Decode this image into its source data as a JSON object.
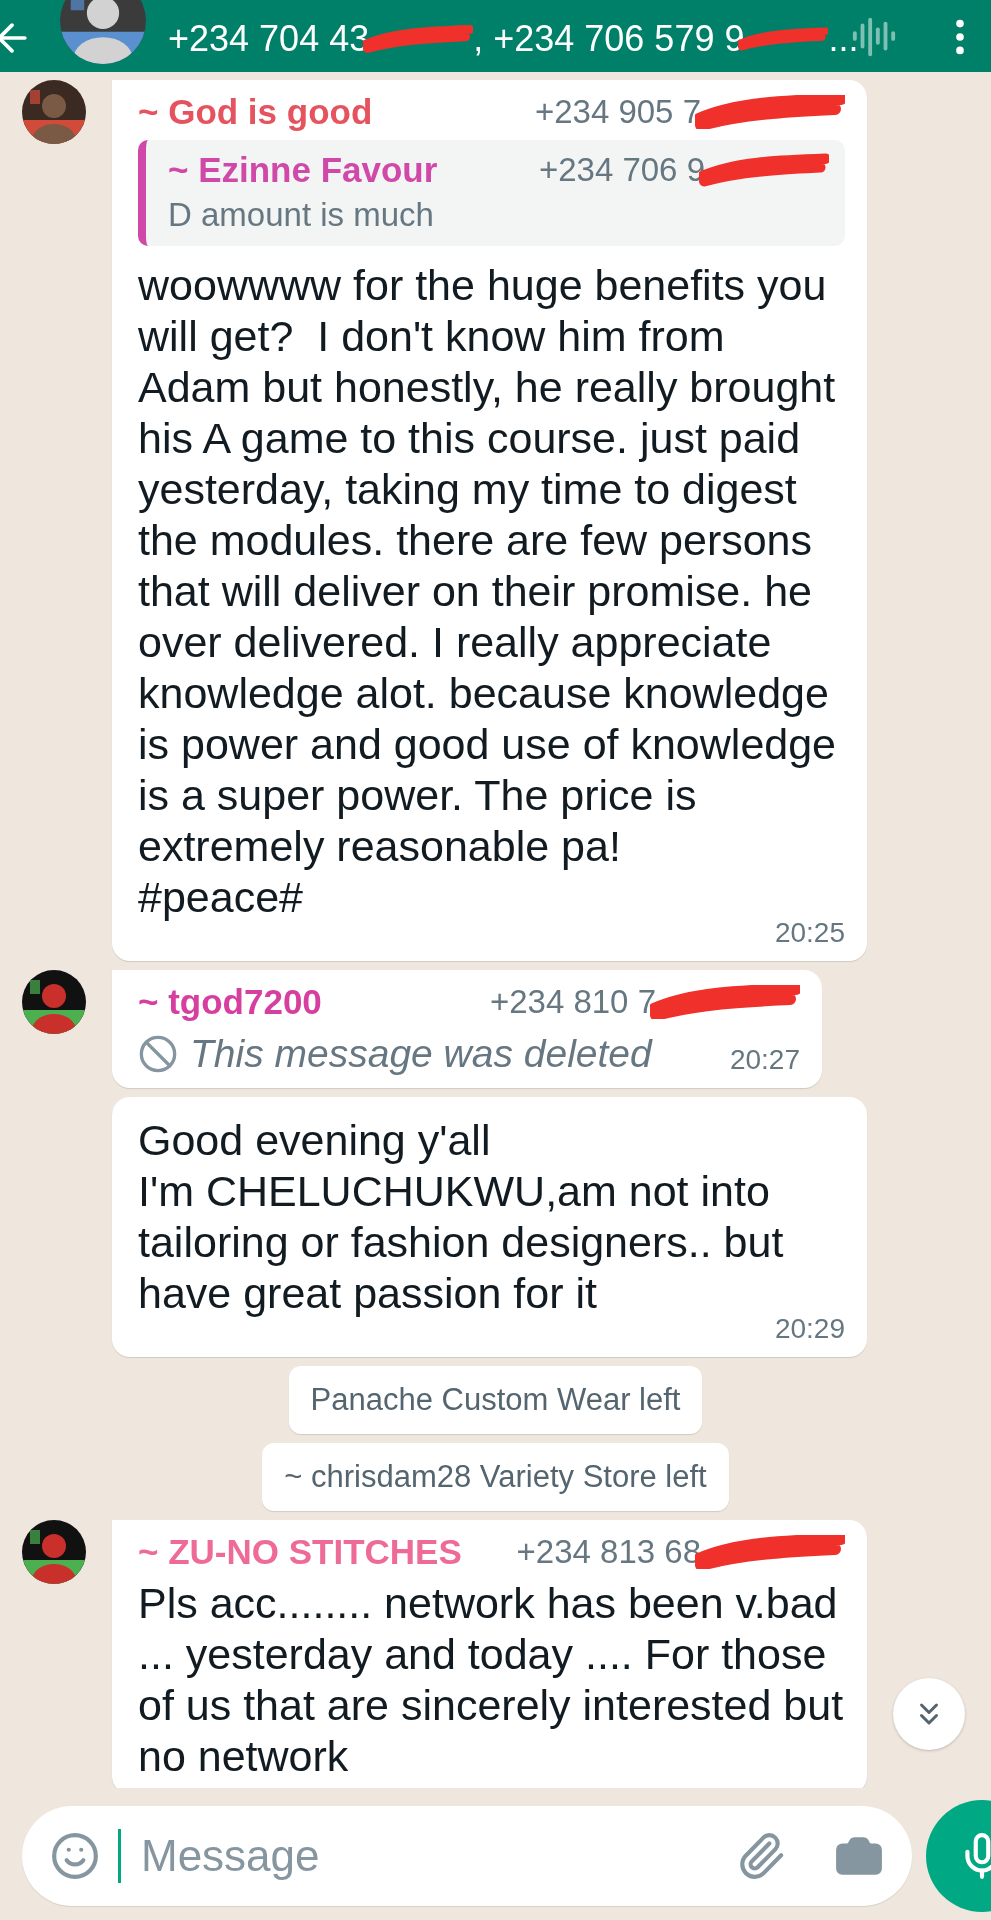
{
  "header": {
    "subtitle": [
      {
        "text": "+234 704 43",
        "redacted": true
      },
      {
        "text": ", +234 706 579 9",
        "redacted": true
      },
      {
        "text": "...",
        "redacted": false
      }
    ]
  },
  "messages": [
    {
      "kind": "text",
      "sender": "~ God is good",
      "phone": "+234 905 7",
      "color": "#e5535f",
      "quote": {
        "sender": "~ Ezinne Favour",
        "phone": "+234 706 9",
        "color": "#d048a8",
        "text": "D amount is much"
      },
      "text": "woowwww for the huge benefits you will get?  I don't know him from Adam but honestly, he really brought his A game to this course. just paid yesterday, taking my time to digest the modules. there are few persons that will deliver on their promise. he over delivered. I really appreciate knowledge alot. because knowledge is power and good use of knowledge is a super power. The price is extremely reasonable pa!\n#peace#",
      "time": "20:25"
    },
    {
      "kind": "deleted",
      "sender": "~ tgod7200",
      "phone": "+234 810 7",
      "color": "#d63fa0",
      "text": "This message was deleted",
      "time": "20:27"
    },
    {
      "kind": "text",
      "text": "Good evening y'all\nI'm CHELUCHUKWU,am not into tailoring or fashion designers.. but have great passion for it",
      "time": "20:29"
    },
    {
      "kind": "system",
      "text": "Panache Custom Wear left"
    },
    {
      "kind": "system",
      "text": "~ chrisdam28 Variety Store left"
    },
    {
      "kind": "text",
      "sender": "~ ZU-NO STITCHES",
      "phone": "+234 813 68",
      "color": "#ee6b98",
      "text": "Pls acc........ network has been v.bad ... yesterday and today .... For those of us that are sincerely interested but no network"
    }
  ],
  "composer": {
    "placeholder": "Message"
  }
}
